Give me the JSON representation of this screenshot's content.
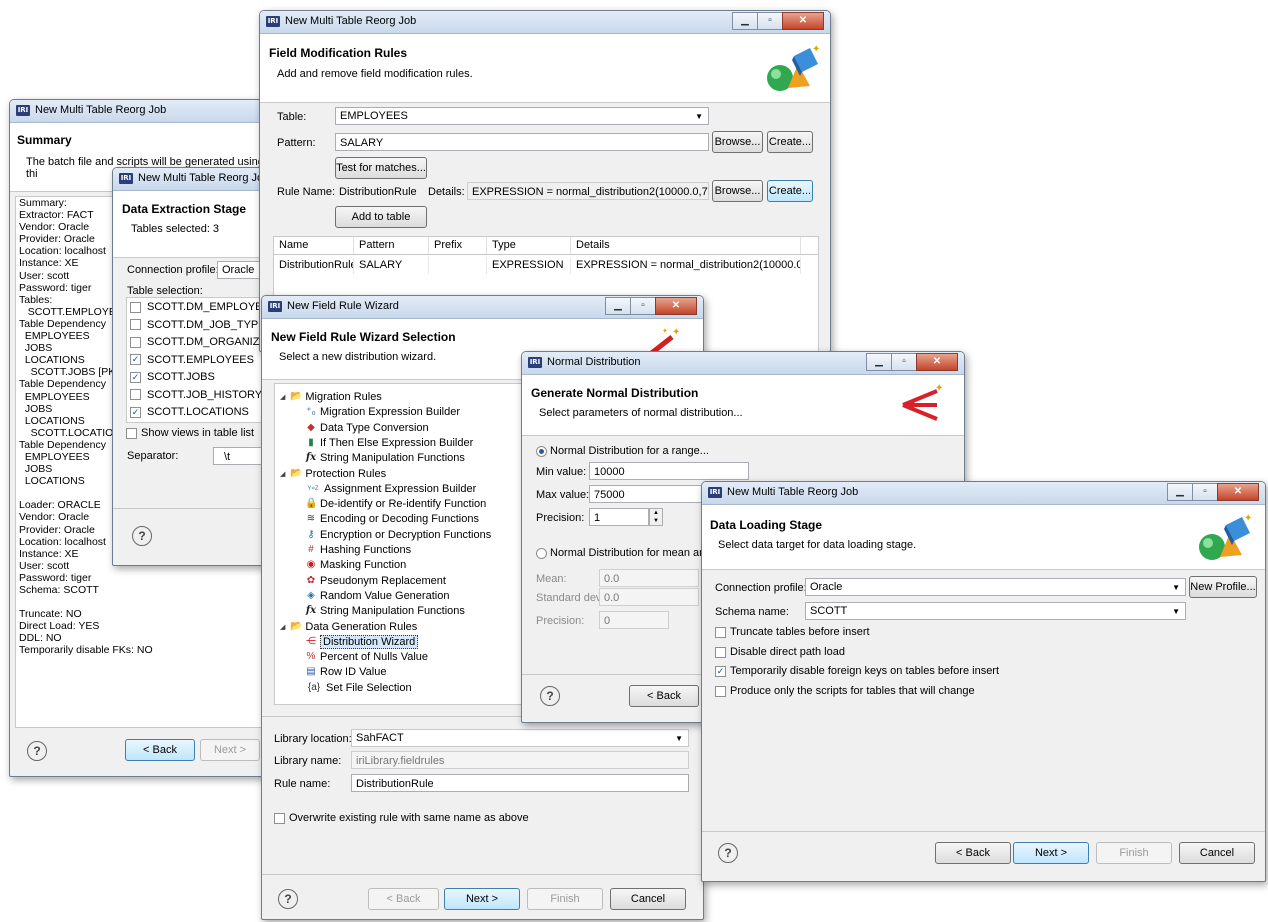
{
  "summary_win": {
    "title": "New Multi Table Reorg Job",
    "header_title": "Summary",
    "header_sub": "The batch file and scripts will be generated using thi",
    "lines": [
      "Summary:",
      "Extractor: FACT",
      "Vendor: Oracle",
      "Provider: Oracle",
      "Location: localhost",
      "Instance: XE",
      "User: scott",
      "Password: tiger",
      "Tables:",
      "   SCOTT.EMPLOYE",
      "Table Dependency",
      "  EMPLOYEES",
      "  JOBS",
      "  LOCATIONS",
      "    SCOTT.JOBS [PK:",
      "Table Dependency",
      "  EMPLOYEES",
      "  JOBS",
      "  LOCATIONS",
      "    SCOTT.LOCATIO",
      "Table Dependency",
      "  EMPLOYEES",
      "  JOBS",
      "  LOCATIONS",
      "",
      "Loader: ORACLE",
      "Vendor: Oracle",
      "Provider: Oracle",
      "Location: localhost",
      "Instance: XE",
      "User: scott",
      "Password: tiger",
      "Schema: SCOTT",
      "",
      "Truncate: NO",
      "Direct Load: YES",
      "DDL: NO",
      "Temporarily disable FKs: NO"
    ],
    "back": "< Back",
    "next": "Next >"
  },
  "extract_win": {
    "title": "New Multi Table Reorg Job",
    "header_title": "Data Extraction Stage",
    "header_sub": "Tables selected: 3",
    "conn_label": "Connection profile:",
    "conn_value": "Oracle",
    "table_sel_label": "Table selection:",
    "tables": [
      {
        "name": "SCOTT.DM_EMPLOYEE_",
        "checked": false
      },
      {
        "name": "SCOTT.DM_JOB_TYPES",
        "checked": false
      },
      {
        "name": "SCOTT.DM_ORGANIZAT",
        "checked": false
      },
      {
        "name": "SCOTT.EMPLOYEES",
        "checked": true
      },
      {
        "name": "SCOTT.JOBS",
        "checked": true
      },
      {
        "name": "SCOTT.JOB_HISTORY",
        "checked": false
      },
      {
        "name": "SCOTT.LOCATIONS",
        "checked": true
      }
    ],
    "show_views": "Show views in table list",
    "separator_label": "Separator:",
    "separator_value": "\\t"
  },
  "fmr_win": {
    "title": "New Multi Table Reorg Job",
    "header_title": "Field Modification Rules",
    "header_sub": "Add and remove field modification rules.",
    "table_label": "Table:",
    "table_value": "EMPLOYEES",
    "pattern_label": "Pattern:",
    "pattern_value": "SALARY",
    "browse": "Browse...",
    "create": "Create...",
    "test": "Test for matches...",
    "rule_name_label": "Rule Name:",
    "rule_name_value": "DistributionRule",
    "details_label": "Details:",
    "details_value": "EXPRESSION = normal_distribution2(10000.0,75000.0",
    "add_to_table": "Add to table",
    "cols": [
      "Name",
      "Pattern",
      "Prefix",
      "Type",
      "Details"
    ],
    "rows": [
      [
        "DistributionRule",
        "SALARY",
        "",
        "EXPRESSION",
        "EXPRESSION = normal_distribution2(10000.0,7..."
      ]
    ]
  },
  "wizard_win": {
    "title": "New Field Rule Wizard",
    "header_title": "New Field Rule Wizard Selection",
    "header_sub": "Select a new distribution wizard.",
    "tree": [
      {
        "label": "Migration Rules",
        "level": 0,
        "icon": "folder-icon",
        "glyph": "📂"
      },
      {
        "label": "Migration Expression Builder",
        "level": 1,
        "icon": "expression-builder-icon",
        "glyph": "⁺₀"
      },
      {
        "label": "Data Type Conversion",
        "level": 1,
        "icon": "data-type-conversion-icon",
        "glyph": "◆"
      },
      {
        "label": "If Then Else Expression Builder",
        "level": 1,
        "icon": "if-then-else-icon",
        "glyph": "▮"
      },
      {
        "label": "String Manipulation Functions",
        "level": 1,
        "icon": "fx-icon",
        "glyph": "fx"
      },
      {
        "label": "Protection Rules",
        "level": 0,
        "icon": "folder-icon",
        "glyph": "📂"
      },
      {
        "label": "Assignment Expression Builder",
        "level": 1,
        "icon": "assignment-icon",
        "glyph": "Y=Z"
      },
      {
        "label": "De-identify or Re-identify Function",
        "level": 1,
        "icon": "lock-icon",
        "glyph": "🔒"
      },
      {
        "label": "Encoding or Decoding Functions",
        "level": 1,
        "icon": "encoding-icon",
        "glyph": "≋"
      },
      {
        "label": "Encryption or Decryption Functions",
        "level": 1,
        "icon": "key-icon",
        "glyph": "⚷"
      },
      {
        "label": "Hashing Functions",
        "level": 1,
        "icon": "hash-icon",
        "glyph": "#"
      },
      {
        "label": "Masking Function",
        "level": 1,
        "icon": "mask-icon",
        "glyph": "◉"
      },
      {
        "label": "Pseudonym Replacement",
        "level": 1,
        "icon": "pseudonym-icon",
        "glyph": "✿"
      },
      {
        "label": "Random Value Generation",
        "level": 1,
        "icon": "dice-icon",
        "glyph": "◈"
      },
      {
        "label": "String Manipulation Functions",
        "level": 1,
        "icon": "fx-icon",
        "glyph": "fx"
      },
      {
        "label": "Data Generation Rules",
        "level": 0,
        "icon": "folder-icon",
        "glyph": "📂"
      },
      {
        "label": "Distribution Wizard",
        "level": 1,
        "icon": "distribution-icon",
        "glyph": "⋲",
        "selected": true
      },
      {
        "label": "Percent of Nulls Value",
        "level": 1,
        "icon": "nulls-icon",
        "glyph": "%"
      },
      {
        "label": "Row ID Value",
        "level": 1,
        "icon": "row-id-icon",
        "glyph": "▤"
      },
      {
        "label": "Set File Selection",
        "level": 1,
        "icon": "set-file-icon",
        "glyph": "{a}"
      }
    ],
    "lib_loc_label": "Library location:",
    "lib_loc_value": "SahFACT",
    "lib_name_label": "Library name:",
    "lib_name_value": "iriLibrary.fieldrules",
    "rule_name_label": "Rule name:",
    "rule_name_value": "DistributionRule",
    "overwrite": "Overwrite existing rule with same name as above",
    "back": "< Back",
    "next": "Next >",
    "finish": "Finish",
    "cancel": "Cancel"
  },
  "normal_win": {
    "title": "Normal Distribution",
    "header_title": "Generate Normal Distribution",
    "header_sub": "Select parameters of normal distribution...",
    "range_label": "Normal Distribution for a range...",
    "min_label": "Min value:",
    "min_value": "10000",
    "max_label": "Max value:",
    "max_value": "75000",
    "prec_label": "Precision:",
    "prec_value": "1",
    "mean_radio_label": "Normal Distribution for mean and",
    "mean_label": "Mean:",
    "mean_value": "0.0",
    "std_label": "Standard dev:",
    "std_value": "0.0",
    "prec2_label": "Precision:",
    "prec2_value": "0",
    "back": "< Back"
  },
  "loading_win": {
    "title": "New Multi Table Reorg Job",
    "header_title": "Data Loading Stage",
    "header_sub": "Select data target for data loading stage.",
    "conn_label": "Connection profile:",
    "conn_value": "Oracle",
    "new_profile": "New Profile...",
    "schema_label": "Schema name:",
    "schema_value": "SCOTT",
    "opts": [
      {
        "label": "Truncate tables before insert",
        "checked": false
      },
      {
        "label": "Disable direct path load",
        "checked": false
      },
      {
        "label": "Temporarily disable foreign keys on tables before insert",
        "checked": true
      },
      {
        "label": "Produce only the scripts for tables that will change",
        "checked": false
      }
    ],
    "back": "< Back",
    "next": "Next >",
    "finish": "Finish",
    "cancel": "Cancel"
  },
  "app_icon_text": "IRI",
  "help_glyph": "?"
}
